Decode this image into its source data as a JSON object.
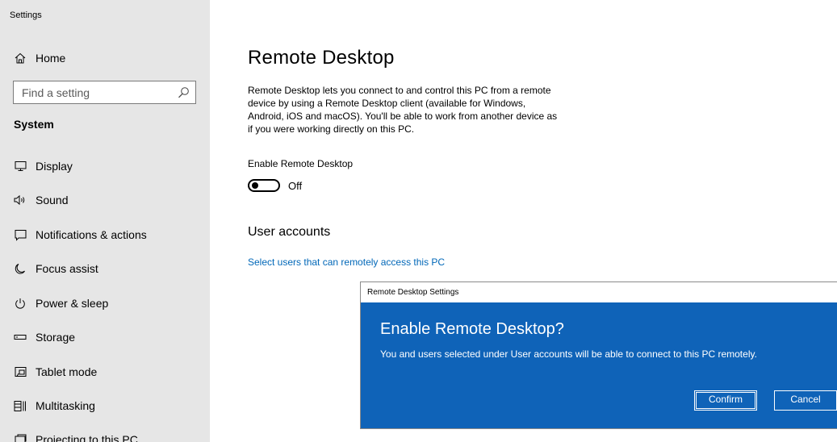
{
  "window": {
    "title": "Settings"
  },
  "sidebar": {
    "home_label": "Home",
    "search_placeholder": "Find a setting",
    "section_label": "System",
    "items": [
      {
        "label": "Display",
        "icon": "display-icon"
      },
      {
        "label": "Sound",
        "icon": "sound-icon"
      },
      {
        "label": "Notifications & actions",
        "icon": "notifications-icon"
      },
      {
        "label": "Focus assist",
        "icon": "moon-icon"
      },
      {
        "label": "Power & sleep",
        "icon": "power-icon"
      },
      {
        "label": "Storage",
        "icon": "storage-icon"
      },
      {
        "label": "Tablet mode",
        "icon": "tablet-mode-icon"
      },
      {
        "label": "Multitasking",
        "icon": "multitasking-icon"
      },
      {
        "label": "Projecting to this PC",
        "icon": "projecting-icon"
      }
    ]
  },
  "main": {
    "title": "Remote Desktop",
    "description": "Remote Desktop lets you connect to and control this PC from a remote device by using a Remote Desktop client (available for Windows, Android, iOS and macOS). You'll be able to work from another device as if you were working directly on this PC.",
    "toggle_label": "Enable Remote Desktop",
    "toggle_state": "Off",
    "toggle_on": false,
    "user_accounts_heading": "User accounts",
    "user_accounts_link": "Select users that can remotely access this PC"
  },
  "dialog": {
    "window_title": "Remote Desktop Settings",
    "heading": "Enable Remote Desktop?",
    "body": "You and users selected under User accounts will be able to connect to this PC remotely.",
    "confirm_label": "Confirm",
    "cancel_label": "Cancel"
  },
  "colors": {
    "sidebar_bg": "#e6e6e6",
    "accent": "#0067b8",
    "dialog_bg": "#0f63b8"
  }
}
